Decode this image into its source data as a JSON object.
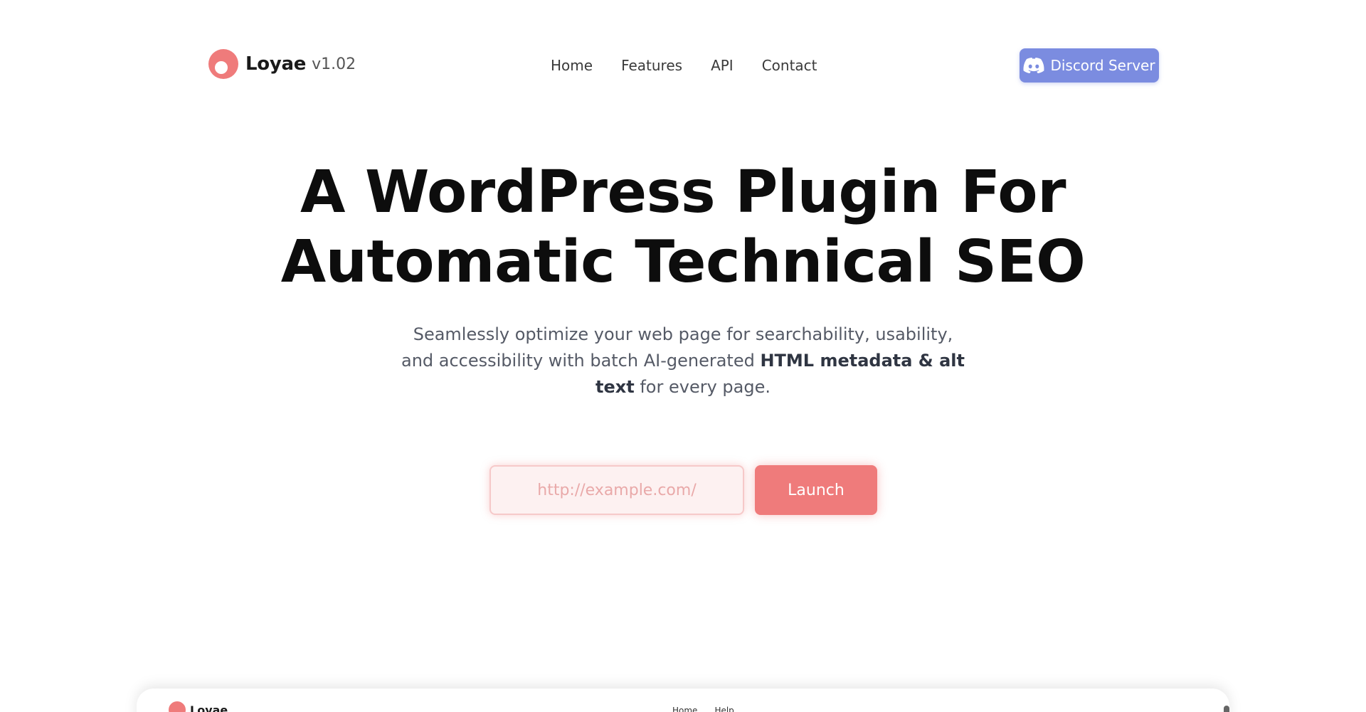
{
  "header": {
    "brand_name": "Loyae",
    "brand_version": "v1.02",
    "nav": [
      {
        "label": "Home"
      },
      {
        "label": "Features"
      },
      {
        "label": "API"
      },
      {
        "label": "Contact"
      }
    ],
    "discord_label": "Discord Server",
    "discord_icon": "discord-icon"
  },
  "hero": {
    "title_line1": "A WordPress Plugin For",
    "title_line2": "Automatic Technical SEO",
    "subtitle_part1": "Seamlessly optimize your web page for searchability, usability, and accessibility with batch AI-generated ",
    "subtitle_bold": "HTML metadata & alt text",
    "subtitle_part2": " for every page.",
    "url_placeholder": "http://example.com/",
    "launch_label": "Launch"
  },
  "preview": {
    "brand_name": "Loyae",
    "nav": [
      {
        "label": "Home"
      },
      {
        "label": "Help"
      }
    ]
  },
  "colors": {
    "accent": "#ef7b7b",
    "discord": "#7b8ce0",
    "heading": "#0d0d0d",
    "body_text": "#555a66"
  }
}
